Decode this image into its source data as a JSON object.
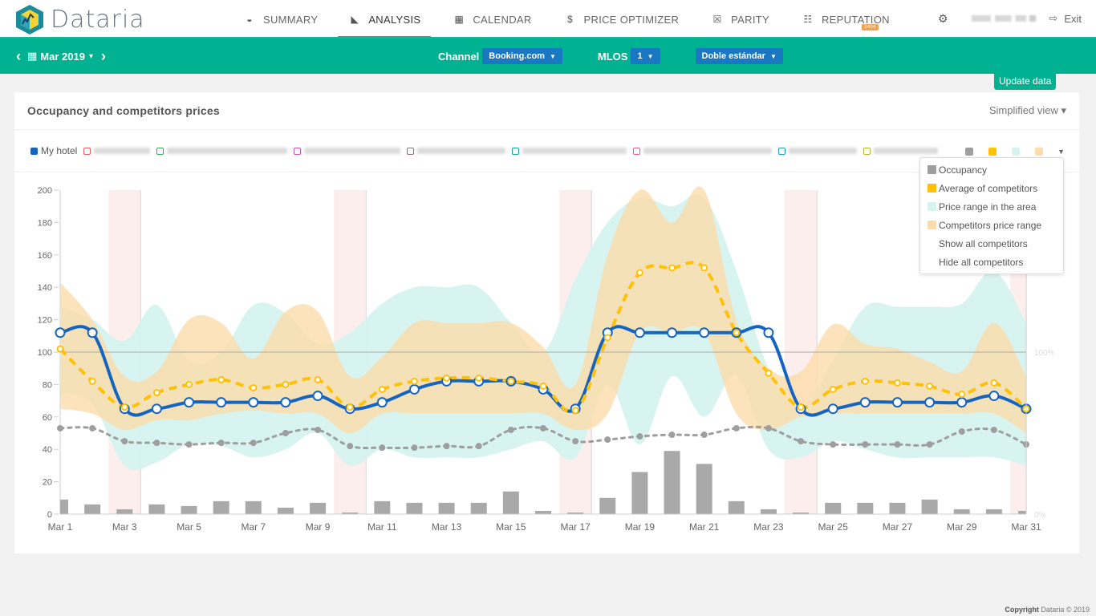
{
  "app": {
    "brand": "Dataria",
    "nav": [
      {
        "label": "SUMMARY",
        "icon": "dashboard-icon",
        "glyph": "◒",
        "active": false
      },
      {
        "label": "ANALYSIS",
        "icon": "area-chart-icon",
        "glyph": "◣",
        "active": true
      },
      {
        "label": "CALENDAR",
        "icon": "calendar-icon",
        "glyph": "▦",
        "active": false
      },
      {
        "label": "PRICE OPTIMIZER",
        "icon": "dollar-icon",
        "glyph": "$",
        "active": false
      },
      {
        "label": "PARITY",
        "icon": "close-square-icon",
        "glyph": "☒",
        "active": false
      },
      {
        "label": "REPUTATION",
        "icon": "comments-icon",
        "glyph": "☷",
        "active": false,
        "badge": "2404"
      }
    ],
    "settings_icon": "⚙",
    "exit_label": "Exit",
    "exit_glyph": "⇨"
  },
  "toolbar": {
    "prev": "‹",
    "next": "›",
    "calendar_glyph": "▦",
    "month": "Mar 2019",
    "month_caret": "▾",
    "channel_label": "Channel",
    "channel_value": "Booking.com",
    "mlos_label": "MLOS",
    "mlos_value": "1",
    "room_value": "Doble estándar",
    "caret": "▼",
    "update_label": "Update data"
  },
  "card": {
    "title": "Occupancy and competitors prices",
    "view_label": "Simplified view ▾"
  },
  "legend": {
    "my_hotel": "My hotel",
    "competitors": [
      {
        "color": "#e06060",
        "blur_w": 70
      },
      {
        "color": "#3aa655",
        "blur_w": 150
      },
      {
        "color": "#c850c0",
        "blur_w": 120
      },
      {
        "color": "#8a7070",
        "blur_w": 110
      },
      {
        "color": "#14a5a5",
        "blur_w": 130
      },
      {
        "color": "#e06090",
        "blur_w": 160
      },
      {
        "color": "#1a9fbf",
        "blur_w": 85
      },
      {
        "color": "#b5b530",
        "blur_w": 80
      }
    ],
    "toggles": [
      {
        "name": "occupancy",
        "color": "#9e9e9e"
      },
      {
        "name": "average-of-competitors",
        "color": "#ffc107"
      },
      {
        "name": "price-range-area",
        "color": "#d6f3ef"
      },
      {
        "name": "competitors-price-range",
        "color": "#fcdcaa"
      }
    ],
    "caret": "▼"
  },
  "menu": {
    "items": [
      {
        "label": "Occupancy",
        "color": "#9e9e9e"
      },
      {
        "label": "Average of competitors",
        "color": "#ffc107"
      },
      {
        "label": "Price range in the area",
        "color": "#d6f3ef"
      },
      {
        "label": "Competitors price range",
        "color": "#fcdcaa"
      },
      {
        "label": "Show all competitors",
        "color": null
      },
      {
        "label": "Hide all competitors",
        "color": null
      }
    ]
  },
  "footer": {
    "bold": "Copyright",
    "rest": " Dataria © 2019"
  },
  "chart_data": {
    "type": "line",
    "title": "Occupancy and competitors prices",
    "x": [
      "Mar 1",
      "Mar 2",
      "Mar 3",
      "Mar 4",
      "Mar 5",
      "Mar 6",
      "Mar 7",
      "Mar 8",
      "Mar 9",
      "Mar 10",
      "Mar 11",
      "Mar 12",
      "Mar 13",
      "Mar 14",
      "Mar 15",
      "Mar 16",
      "Mar 17",
      "Mar 18",
      "Mar 19",
      "Mar 20",
      "Mar 21",
      "Mar 22",
      "Mar 23",
      "Mar 24",
      "Mar 25",
      "Mar 26",
      "Mar 27",
      "Mar 28",
      "Mar 29",
      "Mar 30",
      "Mar 31"
    ],
    "x_tick_labels": [
      "Mar 1",
      "Mar 3",
      "Mar 5",
      "Mar 7",
      "Mar 9",
      "Mar 11",
      "Mar 13",
      "Mar 15",
      "Mar 17",
      "Mar 19",
      "Mar 21",
      "Mar 23",
      "Mar 25",
      "Mar 27",
      "Mar 29",
      "Mar 31"
    ],
    "ylim": [
      0,
      200
    ],
    "y_ticks": [
      0,
      20,
      40,
      60,
      80,
      100,
      120,
      140,
      160,
      180,
      200
    ],
    "y2_ticks": [
      {
        "value": 100,
        "label": "100%"
      },
      {
        "value": 0,
        "label": "0%"
      }
    ],
    "weekend_bands": [
      [
        2,
        3
      ],
      [
        9,
        10
      ],
      [
        16,
        17
      ],
      [
        23,
        24
      ],
      [
        30,
        31
      ]
    ],
    "series": [
      {
        "name": "My hotel",
        "type": "line",
        "color": "#1565c0",
        "values": [
          112,
          112,
          65,
          65,
          69,
          69,
          69,
          69,
          73,
          65,
          69,
          77,
          82,
          82,
          82,
          77,
          65,
          112,
          112,
          112,
          112,
          112,
          112,
          65,
          65,
          69,
          69,
          69,
          69,
          73,
          65
        ]
      },
      {
        "name": "Average of competitors",
        "type": "dashed-line",
        "color": "#ffc107",
        "values": [
          102,
          82,
          66,
          75,
          80,
          83,
          78,
          80,
          83,
          66,
          77,
          82,
          84,
          84,
          82,
          79,
          64,
          109,
          149,
          152,
          152,
          112,
          87,
          66,
          77,
          82,
          81,
          79,
          74,
          81,
          65
        ]
      },
      {
        "name": "Occupancy (%)",
        "type": "dotted-line",
        "color": "#9e9e9e",
        "values": [
          53,
          53,
          45,
          44,
          43,
          44,
          44,
          50,
          52,
          42,
          41,
          41,
          42,
          42,
          52,
          53,
          45,
          46,
          48,
          49,
          49,
          53,
          53,
          45,
          43,
          43,
          43,
          43,
          51,
          52,
          43
        ]
      },
      {
        "name": "Occupancy bars",
        "type": "bar",
        "color": "#a9a9a9",
        "values": [
          9,
          6,
          3,
          6,
          5,
          8,
          8,
          4,
          7,
          1,
          8,
          7,
          7,
          7,
          14,
          2,
          1,
          10,
          26,
          39,
          31,
          8,
          3,
          1,
          7,
          7,
          7,
          9,
          3,
          3,
          2
        ]
      },
      {
        "name": "Price range in the area",
        "type": "area-range",
        "color": "#d6f3ef",
        "low": [
          75,
          68,
          30,
          32,
          43,
          42,
          35,
          40,
          50,
          30,
          40,
          35,
          35,
          35,
          40,
          45,
          35,
          80,
          43,
          85,
          60,
          85,
          40,
          35,
          45,
          40,
          35,
          35,
          35,
          35,
          30
        ],
        "high": [
          128,
          120,
          107,
          129,
          95,
          100,
          129,
          124,
          105,
          112,
          130,
          140,
          140,
          140,
          118,
          100,
          145,
          180,
          195,
          190,
          195,
          150,
          90,
          65,
          95,
          128,
          128,
          128,
          130,
          150,
          118
        ]
      },
      {
        "name": "Competitors price range",
        "type": "area-range",
        "color": "#fcdcaa",
        "low": [
          65,
          62,
          52,
          58,
          58,
          62,
          64,
          62,
          62,
          50,
          62,
          62,
          62,
          62,
          62,
          62,
          52,
          62,
          112,
          112,
          112,
          62,
          52,
          60,
          62,
          62,
          62,
          62,
          62,
          62,
          50
        ],
        "high": [
          143,
          120,
          85,
          88,
          120,
          118,
          96,
          125,
          125,
          85,
          97,
          118,
          118,
          118,
          118,
          103,
          80,
          160,
          200,
          180,
          200,
          120,
          90,
          88,
          117,
          105,
          102,
          94,
          88,
          118,
          85
        ]
      }
    ]
  }
}
